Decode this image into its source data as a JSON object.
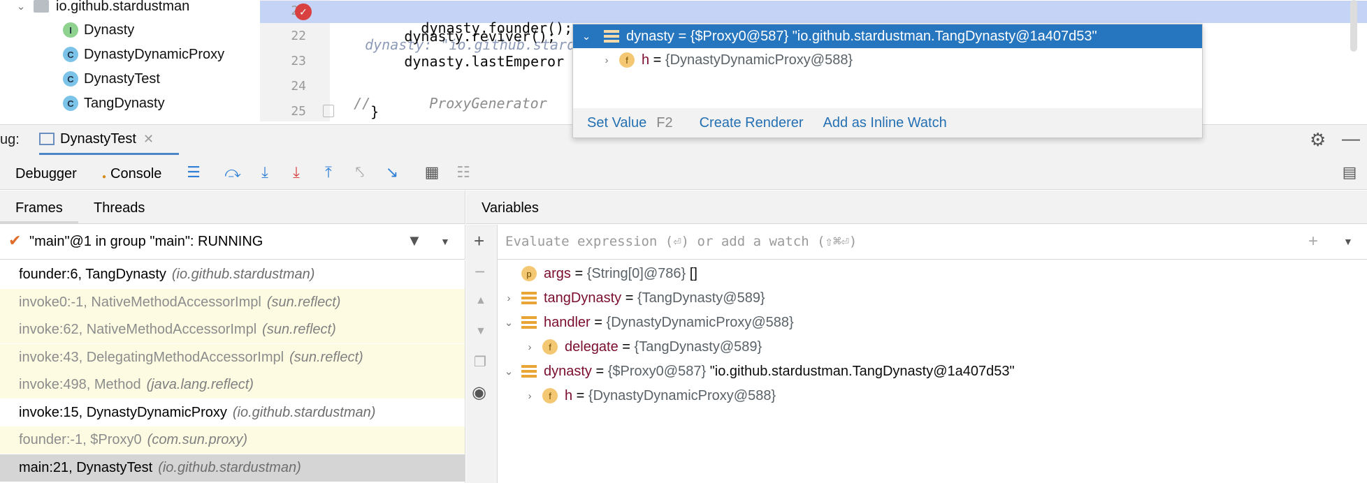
{
  "project_tree": {
    "package": "io.github.stardustman",
    "items": [
      {
        "kind": "I",
        "label": "Dynasty"
      },
      {
        "kind": "C",
        "label": "DynastyDynamicProxy"
      },
      {
        "kind": "C",
        "label": "DynastyTest"
      },
      {
        "kind": "C",
        "label": "TangDynasty"
      }
    ]
  },
  "editor": {
    "lines": [
      {
        "num": "21",
        "code": "        dynasty.founder();",
        "inline": "dynasty: \"io.github.stardustman.TangDynasty@1a407d53\""
      },
      {
        "num": "22",
        "code": "        dynasty.reviver();",
        "inline": ""
      },
      {
        "num": "23",
        "code": "        dynasty.lastEmperor",
        "inline": ""
      },
      {
        "num": "24",
        "code": "//",
        "inline": "ProxyGenerator"
      },
      {
        "num": "25",
        "code": "    }",
        "inline": ""
      }
    ]
  },
  "popup": {
    "selected": {
      "name": "dynasty",
      "eq": " = ",
      "type": "{$Proxy0@587}",
      "value": " \"io.github.stardustman.TangDynasty@1a407d53\""
    },
    "child": {
      "icon": "f",
      "name": "h",
      "eq": " = ",
      "type": "{DynastyDynamicProxy@588}"
    },
    "actions": {
      "set_value": "Set Value",
      "set_value_key": "F2",
      "create_renderer": "Create Renderer",
      "add_inline_watch": "Add as Inline Watch"
    }
  },
  "debug": {
    "label": "ug:",
    "session_tab": "DynastyTest",
    "tabs": {
      "debugger": "Debugger",
      "console": "Console"
    },
    "frames_tab": "Frames",
    "threads_tab": "Threads",
    "variables_title": "Variables",
    "thread_status": "\"main\"@1 in group \"main\": RUNNING",
    "watch_placeholder": "Evaluate expression (⏎) or add a watch (⇧⌘⏎)"
  },
  "frames": [
    {
      "method": "founder:6, TangDynasty",
      "pkg": "(io.github.stardustman)",
      "style": "user"
    },
    {
      "method": "invoke0:-1, NativeMethodAccessorImpl",
      "pkg": "(sun.reflect)",
      "style": "lib"
    },
    {
      "method": "invoke:62, NativeMethodAccessorImpl",
      "pkg": "(sun.reflect)",
      "style": "lib"
    },
    {
      "method": "invoke:43, DelegatingMethodAccessorImpl",
      "pkg": "(sun.reflect)",
      "style": "lib"
    },
    {
      "method": "invoke:498, Method",
      "pkg": "(java.lang.reflect)",
      "style": "lib"
    },
    {
      "method": "invoke:15, DynastyDynamicProxy",
      "pkg": "(io.github.stardustman)",
      "style": "user"
    },
    {
      "method": "founder:-1, $Proxy0",
      "pkg": "(com.sun.proxy)",
      "style": "lib"
    },
    {
      "method": "main:21, DynastyTest",
      "pkg": "(io.github.stardustman)",
      "style": "sel"
    }
  ],
  "variables": [
    {
      "icon": "p",
      "name": "args",
      "type": "{String[0]@786}",
      "value": " []",
      "expand": "",
      "indent": 0
    },
    {
      "icon": "list",
      "name": "tangDynasty",
      "type": "{TangDynasty@589}",
      "value": "",
      "expand": "›",
      "indent": 0
    },
    {
      "icon": "list",
      "name": "handler",
      "type": "{DynastyDynamicProxy@588}",
      "value": "",
      "expand": "⌄",
      "indent": 0
    },
    {
      "icon": "f",
      "name": "delegate",
      "type": "{TangDynasty@589}",
      "value": "",
      "expand": "›",
      "indent": 1
    },
    {
      "icon": "list",
      "name": "dynasty",
      "type": "{$Proxy0@587}",
      "value": " \"io.github.stardustman.TangDynasty@1a407d53\"",
      "expand": "⌄",
      "indent": 0
    },
    {
      "icon": "f",
      "name": "h",
      "type": "{DynastyDynamicProxy@588}",
      "value": "",
      "expand": "›",
      "indent": 1
    }
  ]
}
